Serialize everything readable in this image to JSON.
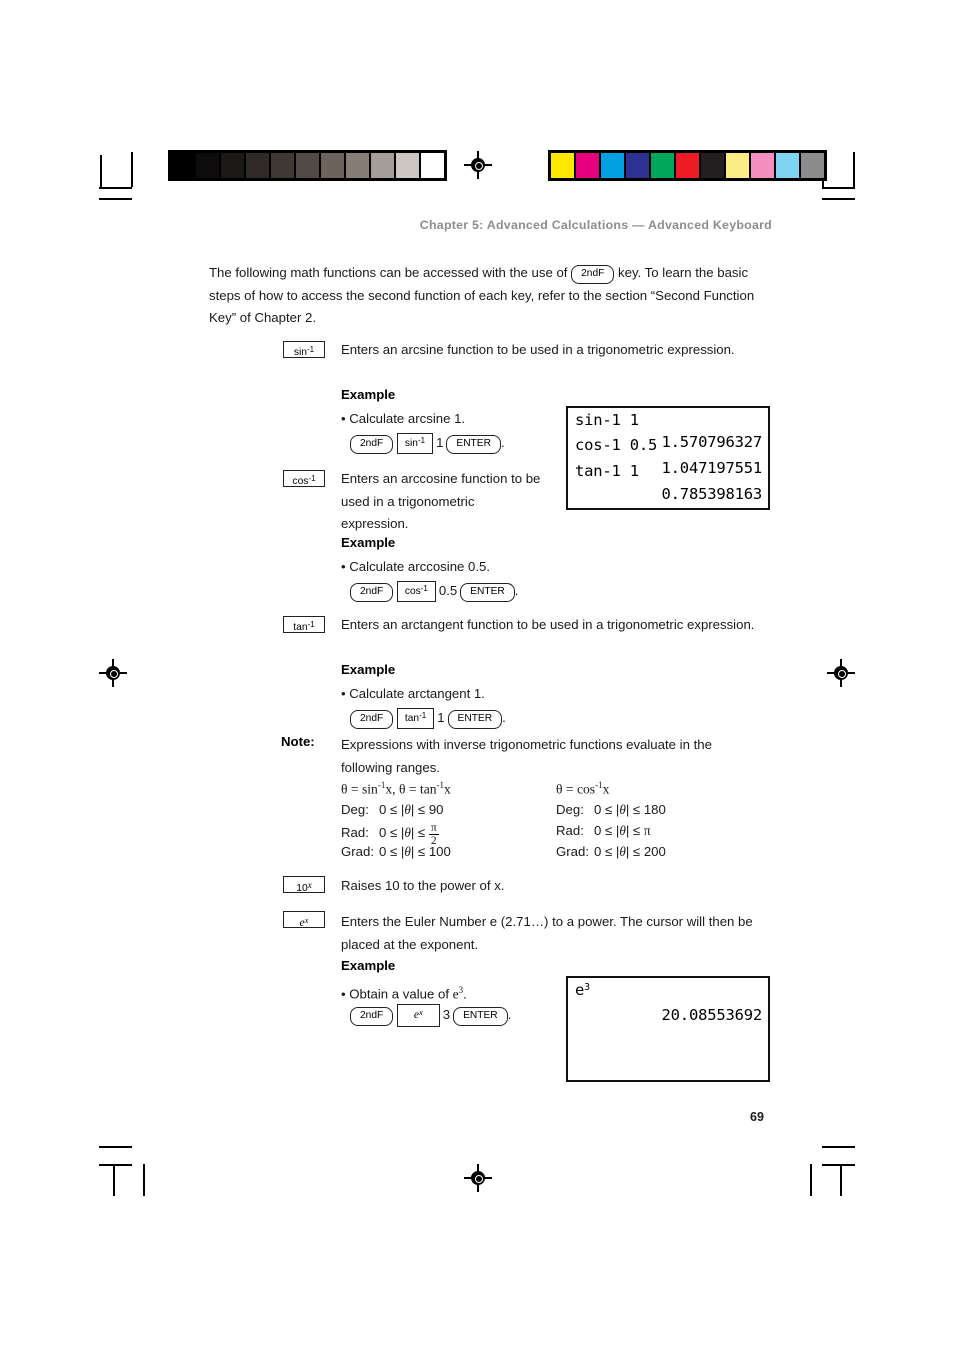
{
  "page": {
    "header": "Chapter 5: Advanced Calculations — Advanced Keyboard",
    "number": "69"
  },
  "intro": {
    "part1": "The following math functions can be accessed with the use of",
    "key": "2ndF",
    "part2": "key. To learn the basic steps of how to access the second function of each key, refer to the section “Second Function Key” of Chapter 2."
  },
  "sections": [
    {
      "key_label": "sin",
      "key_sup": "-1",
      "description": "Enters an arcsine function to be used in a trigonometric expression.",
      "example_title": "Example",
      "bullet": "• Calculate arcsine 1.",
      "sequence": {
        "k1": "2ndF",
        "k2": "sin",
        "k2sup": "-1",
        "value": "1",
        "k3": "ENTER",
        "period": "."
      }
    },
    {
      "key_label": "cos",
      "key_sup": "-1",
      "description": "Enters an arccosine function to be used in a trigonometric expression.",
      "example_title": "Example",
      "bullet": "• Calculate arccosine 0.5.",
      "sequence": {
        "k1": "2ndF",
        "k2": "cos",
        "k2sup": "-1",
        "value": "0.5",
        "k3": "ENTER",
        "period": "."
      }
    },
    {
      "key_label": "tan",
      "key_sup": "-1",
      "description": "Enters an arctangent function to be used in a trigonometric expression.",
      "example_title": "Example",
      "bullet": "• Calculate arctangent 1.",
      "sequence": {
        "k1": "2ndF",
        "k2": "tan",
        "k2sup": "-1",
        "value": "1",
        "k3": "ENTER",
        "period": "."
      }
    }
  ],
  "note": {
    "label": "Note:",
    "text": "Expressions with inverse trigonometric functions evaluate in the following ranges."
  },
  "ranges": {
    "left": {
      "heading_pre": "θ = sin",
      "heading": "θ = sin-1x, θ = tan-1x",
      "rows": [
        {
          "unit": "Deg:",
          "expr": "0 ≤ |θ| ≤ 90",
          "limit": "90"
        },
        {
          "unit": "Rad:",
          "expr": "0 ≤ |θ| ≤ π/2",
          "limit": "π/2"
        },
        {
          "unit": "Grad:",
          "expr": "0 ≤ |θ| ≤ 100",
          "limit": "100"
        }
      ]
    },
    "right": {
      "heading": "θ = cos-1x",
      "rows": [
        {
          "unit": "Deg:",
          "expr": "0 ≤ |θ| ≤ 180",
          "limit": "180"
        },
        {
          "unit": "Rad:",
          "expr": "0 ≤ |θ| ≤ π",
          "limit": "π"
        },
        {
          "unit": "Grad:",
          "expr": "0 ≤ |θ| ≤ 200",
          "limit": "200"
        }
      ]
    }
  },
  "pow10": {
    "key_label": "10",
    "key_sup": "x",
    "description": "Raises 10 to the power of x."
  },
  "euler": {
    "key_label": "e",
    "key_sup": "x",
    "description": "Enters the Euler Number e (2.71…) to a power. The cursor will then be placed at the exponent.",
    "example_title": "Example",
    "bullet": "• Obtain a value of e3.",
    "sequence": {
      "k1": "2ndF",
      "k2": "e",
      "k2sup": "x",
      "value": "3",
      "k3": "ENTER",
      "period": "."
    }
  },
  "lcd_top": {
    "lines": [
      {
        "input": "sin-1 1",
        "result": "1.570796327"
      },
      {
        "input": "cos-1 0.5",
        "result": "1.047197551"
      },
      {
        "input": "tan-1 1",
        "result": "0.785398163"
      }
    ]
  },
  "lcd_bottom": {
    "input_base": "e",
    "input_exp": "3",
    "result": "20.08553692"
  },
  "calibration": {
    "grayscale": [
      "#000000",
      "#0d0b0b",
      "#1b1818",
      "#2f2a27",
      "#3f3934",
      "#524b45",
      "#6b635c",
      "#857d76",
      "#a59e98",
      "#cbc6c1",
      "#ffffff"
    ],
    "color": [
      "#ffe800",
      "#e6007e",
      "#00a0e3",
      "#2e3192",
      "#00a65a",
      "#ed1c24",
      "#231f20",
      "#fbec84",
      "#f48fc0",
      "#7fd4f4",
      "#8c8c8c"
    ]
  }
}
